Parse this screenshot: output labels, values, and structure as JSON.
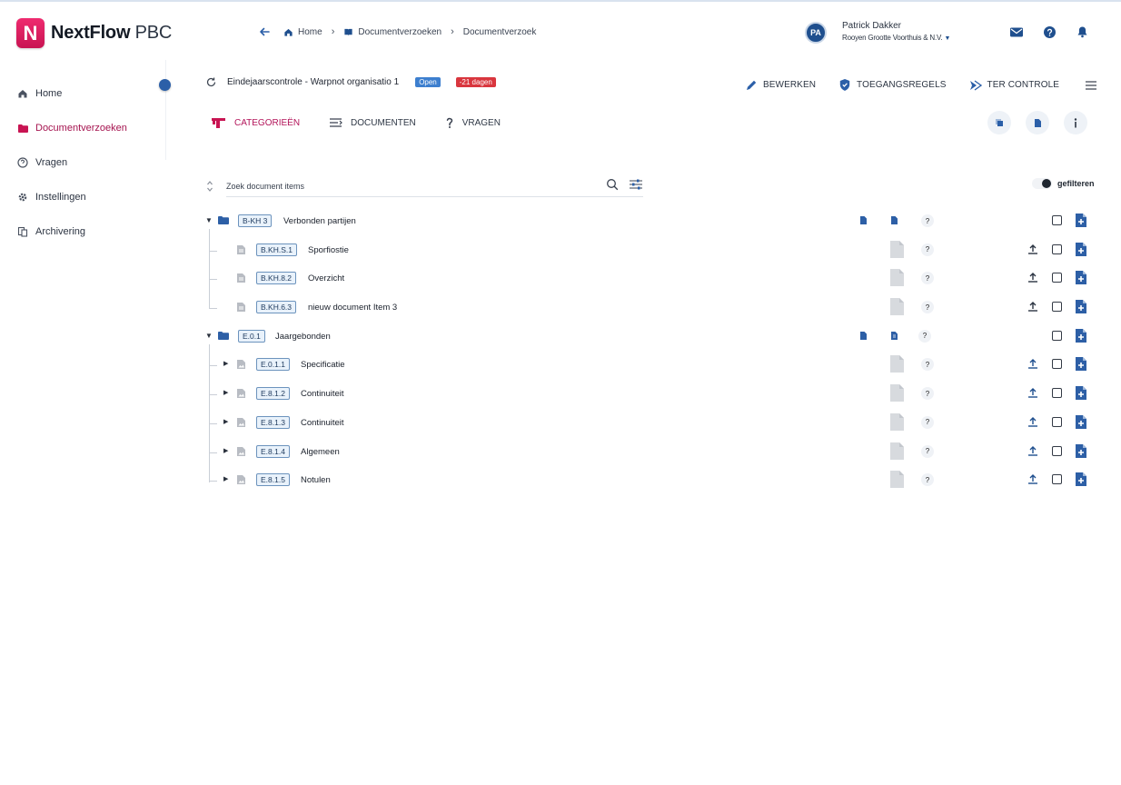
{
  "app": {
    "logo_letter": "N",
    "name_bold": "NextFlow",
    "name_light": "PBC"
  },
  "breadcrumb": [
    {
      "label": "Home"
    },
    {
      "label": "Documentverzoeken"
    },
    {
      "label": "Documentverzoek"
    }
  ],
  "user": {
    "initials": "PA",
    "name": "Patrick Dakker",
    "org": "Rooyen Grootte Voorthuis & N.V."
  },
  "sidebar": {
    "items": [
      {
        "label": "Home"
      },
      {
        "label": "Documentverzoeken"
      },
      {
        "label": "Vragen"
      },
      {
        "label": "Instellingen"
      },
      {
        "label": "Archivering"
      }
    ]
  },
  "request": {
    "title": "Eindejaarscontrole - Warpnot organisatio 1",
    "status_badge": "Open",
    "deadline_badge": "-21 dagen"
  },
  "actions": {
    "edit": "BEWERKEN",
    "access": "TOEGANGSREGELS",
    "review": "TER CONTROLE"
  },
  "tabs": [
    {
      "label": "CATEGORIEËN"
    },
    {
      "label": "DOCUMENTEN"
    },
    {
      "label": "VRAGEN"
    }
  ],
  "search": {
    "placeholder": "Zoek document items"
  },
  "toggle": {
    "label": "gefilteren"
  },
  "colors": {
    "brand": "#c81452",
    "accent": "#a5134f",
    "folder_blue": "#2d5fa6",
    "code_border": "#6c93bd",
    "deadline_red": "#d9363e",
    "status_blue": "#3d7fcf"
  },
  "tree": {
    "groups": [
      {
        "code": "B-KH 3",
        "label": "Verbonden partijen",
        "items": [
          {
            "code": "B.KH.S.1",
            "label": "Sporfiostie"
          },
          {
            "code": "B.KH.8.2",
            "label": "Overzicht"
          },
          {
            "code": "B.KH.6.3",
            "label": "nieuw document Item 3"
          }
        ]
      },
      {
        "code": "E.0.1",
        "label": "Jaargebonden",
        "items": [
          {
            "code": "E.0.1.1",
            "label": "Specificatie"
          },
          {
            "code": "E.8.1.2",
            "label": "Continuiteit"
          },
          {
            "code": "E.8.1.3",
            "label": "Continuiteit"
          },
          {
            "code": "E.8.1.4",
            "label": "Algemeen"
          },
          {
            "code": "E.8.1.5",
            "label": "Notulen"
          }
        ]
      }
    ]
  },
  "row_widgets": {
    "question_mark": "?"
  }
}
